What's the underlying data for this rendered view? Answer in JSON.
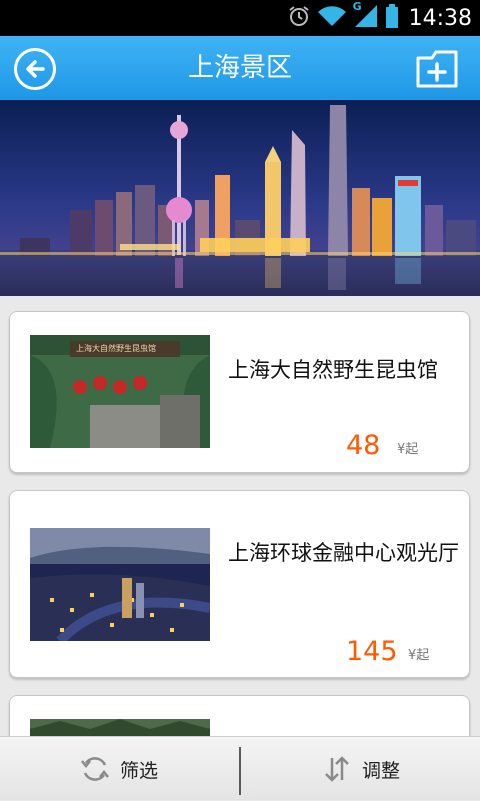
{
  "status_bar": {
    "time": "14:38",
    "network_label": "G"
  },
  "header": {
    "title": "上海景区",
    "back_icon": "back-arrow-icon",
    "add_icon": "folder-add-icon"
  },
  "banner": {
    "alt": ""
  },
  "list": {
    "items": [
      {
        "name": "上海大自然野生昆虫馆",
        "price": "48",
        "unit": "¥起",
        "thumb_sign": "上海大自然野生昆虫馆"
      },
      {
        "name": "上海环球金融中心观光厅",
        "price": "145",
        "unit": "¥起",
        "thumb_sign": ""
      },
      {
        "name": "",
        "price": "",
        "unit": "",
        "thumb_sign": ""
      }
    ]
  },
  "bottom_bar": {
    "filter_label": "筛选",
    "sort_label": "调整"
  },
  "colors": {
    "app_bar": "#2aa3ec",
    "price": "#ff5a00",
    "status_bar": "#000000"
  }
}
